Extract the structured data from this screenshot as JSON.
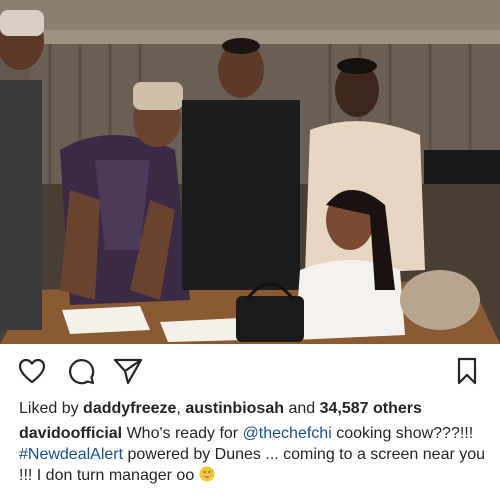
{
  "post": {
    "photo": {
      "description_icon": "photo-image"
    },
    "actions": {
      "like_icon": "heart-icon",
      "comment_icon": "comment-icon",
      "share_icon": "paper-plane-icon",
      "save_icon": "bookmark-icon"
    },
    "likes": {
      "prefix": "Liked by ",
      "user1": "daddyfreeze",
      "sep": ", ",
      "user2": "austinbiosah",
      "and": " and ",
      "count": "34,587 others"
    },
    "caption": {
      "username": "davidoofficial",
      "text1": " Who's ready for ",
      "mention": "@thechefchi",
      "text2": " cooking show???!!! ",
      "hashtag": "#NewdealAlert",
      "text3": " powered by Dunes ... coming to a screen near you !!! I don turn manager oo ",
      "emoji": "grinning-sweat-emoji"
    }
  }
}
